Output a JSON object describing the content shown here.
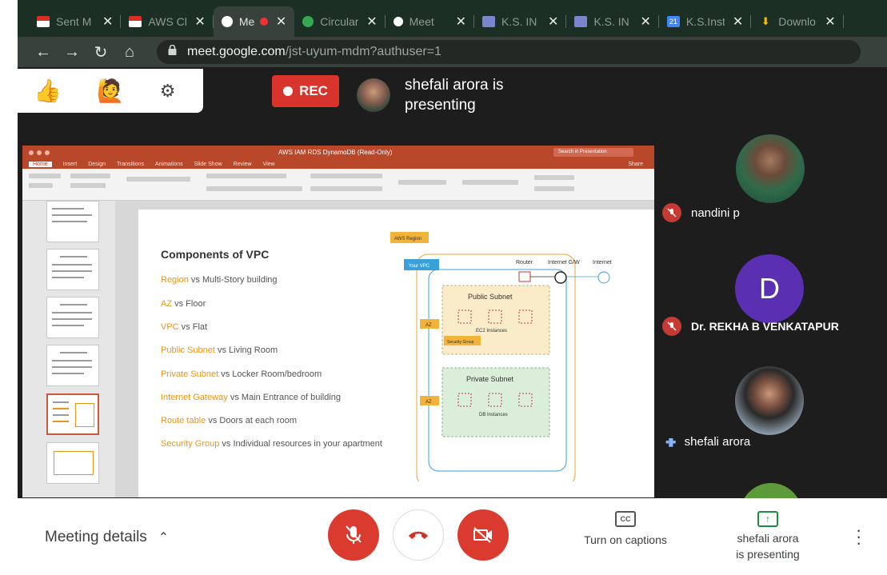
{
  "browser": {
    "tabs": [
      {
        "label": "Sent M",
        "icon": "gmail-icon",
        "color": "#d93025"
      },
      {
        "label": "AWS Cl",
        "icon": "gmail-icon",
        "color": "#d93025"
      },
      {
        "label": "Me",
        "icon": "meet-icon",
        "color": "#ffffff",
        "active": true
      },
      {
        "label": "Circular",
        "icon": "circular-icon",
        "color": "#34a853"
      },
      {
        "label": "Meet",
        "icon": "meet-icon",
        "color": "#ffffff"
      },
      {
        "label": "K.S. IN",
        "icon": "list-icon",
        "color": "#7986cb"
      },
      {
        "label": "K.S. IN",
        "icon": "list-icon",
        "color": "#7986cb"
      },
      {
        "label": "K.S.Inst",
        "icon": "calendar-icon",
        "color": "#4285f4",
        "badge": "21"
      },
      {
        "label": "Downlo",
        "icon": "download-icon",
        "color": "#fbbc04"
      }
    ],
    "url_host": "meet.google.com",
    "url_path": "/jst-uyum-mdm?authuser=1"
  },
  "meet": {
    "rec_label": "REC",
    "presenter_line1": "shefali arora is",
    "presenter_line2": "presenting",
    "participants": [
      {
        "name": "nandini p",
        "status": "muted"
      },
      {
        "name": "Dr. REKHA B VENKATAPUR",
        "status": "muted",
        "initial": "D",
        "avatar_color": "#5b2fb1"
      },
      {
        "name": "shefali arora",
        "status": "speaking"
      }
    ],
    "meeting_details": "Meeting details",
    "captions_label": "Turn on captions",
    "captions_icon": "CC",
    "present_line1": "shefali arora",
    "present_line2": "is presenting"
  },
  "slide": {
    "title": "Components of VPC",
    "items": [
      {
        "key": "Region",
        "rest": " vs Multi-Story building"
      },
      {
        "key": "AZ",
        "rest": " vs Floor"
      },
      {
        "key": "VPC",
        "rest": " vs Flat"
      },
      {
        "key": "Public Subnet",
        "rest": " vs Living Room"
      },
      {
        "key": "Private Subnet",
        "rest": " vs Locker Room/bedroom"
      },
      {
        "key": "Internet Gateway",
        "rest": " vs Main Entrance of building"
      },
      {
        "key": "Route table",
        "rest": " vs Doors at each room"
      },
      {
        "key": "Security Group",
        "rest": " vs Individual resources in your apartment"
      }
    ],
    "diagram": {
      "region": "AWS Region",
      "vpc": "Your VPC",
      "router": "Router",
      "igw": "Internet G/W",
      "internet": "Internet",
      "public_subnet": "Public Subnet",
      "private_subnet": "Private Subnet",
      "az": "AZ",
      "ec2": "EC2 Instances",
      "sg": "Security Group",
      "db": "DB Instances"
    },
    "app_title": "AWS IAM RDS DynamoDB (Read-Only)",
    "app_search": "Search in Presentation",
    "ribbon_tabs": [
      "Home",
      "Insert",
      "Design",
      "Transitions",
      "Animations",
      "Slide Show",
      "Review",
      "View"
    ],
    "share": "Share"
  }
}
